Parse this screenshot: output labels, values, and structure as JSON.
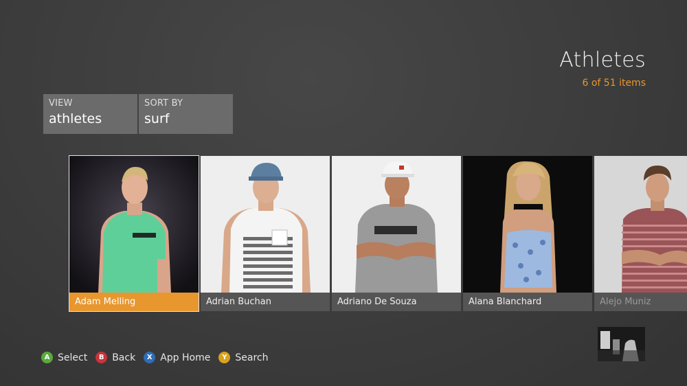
{
  "header": {
    "title": "Athletes",
    "item_count": "6 of 51 items"
  },
  "filters": [
    {
      "label": "VIEW",
      "value": "athletes"
    },
    {
      "label": "SORT BY",
      "value": "surf"
    }
  ],
  "athletes": [
    {
      "name": "Adam Melling",
      "selected": true
    },
    {
      "name": "Adrian Buchan",
      "selected": false
    },
    {
      "name": "Adriano De Souza",
      "selected": false
    },
    {
      "name": "Alana Blanchard",
      "selected": false
    },
    {
      "name": "Alejo Muniz",
      "selected": false
    }
  ],
  "controller_hints": [
    {
      "glyph": "A",
      "label": "Select",
      "color": "#5aa93c"
    },
    {
      "glyph": "B",
      "label": "Back",
      "color": "#c8343a"
    },
    {
      "glyph": "X",
      "label": "App Home",
      "color": "#2f6db5"
    },
    {
      "glyph": "Y",
      "label": "Search",
      "color": "#d9a21d"
    }
  ],
  "colors": {
    "accent": "#e8962e",
    "background": "#3c3c3c",
    "tile_label": "#555555"
  }
}
